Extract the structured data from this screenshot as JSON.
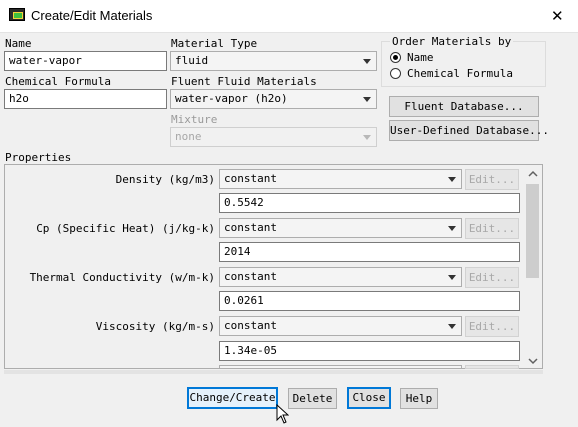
{
  "window": {
    "title": "Create/Edit Materials",
    "close_glyph": "✕"
  },
  "name": {
    "label": "Name",
    "value": "water-vapor"
  },
  "chemical_formula": {
    "label": "Chemical Formula",
    "value": "h2o"
  },
  "material_type": {
    "label": "Material Type",
    "value": "fluid"
  },
  "fluent_fluid_materials": {
    "label": "Fluent Fluid Materials",
    "value": "water-vapor (h2o)"
  },
  "mixture": {
    "label": "Mixture",
    "value": "none"
  },
  "order": {
    "label": "Order Materials by",
    "options": [
      "Name",
      "Chemical Formula"
    ],
    "selected": "Name"
  },
  "buttons_right": {
    "fluent_db": "Fluent Database...",
    "user_db": "User-Defined Database..."
  },
  "properties": {
    "label": "Properties",
    "edit_label": "Edit...",
    "rows": [
      {
        "name": "Density (kg/m3)",
        "method": "constant",
        "value": "0.5542"
      },
      {
        "name": "Cp (Specific Heat) (j/kg-k)",
        "method": "constant",
        "value": "2014"
      },
      {
        "name": "Thermal Conductivity (w/m-k)",
        "method": "constant",
        "value": "0.0261"
      },
      {
        "name": "Viscosity (kg/m-s)",
        "method": "constant",
        "value": "1.34e-05"
      }
    ]
  },
  "footer": {
    "change_create": "Change/Create",
    "delete": "Delete",
    "close": "Close",
    "help": "Help"
  },
  "colors": {
    "accent": "#0078d7",
    "background": "#f0f0f0"
  }
}
